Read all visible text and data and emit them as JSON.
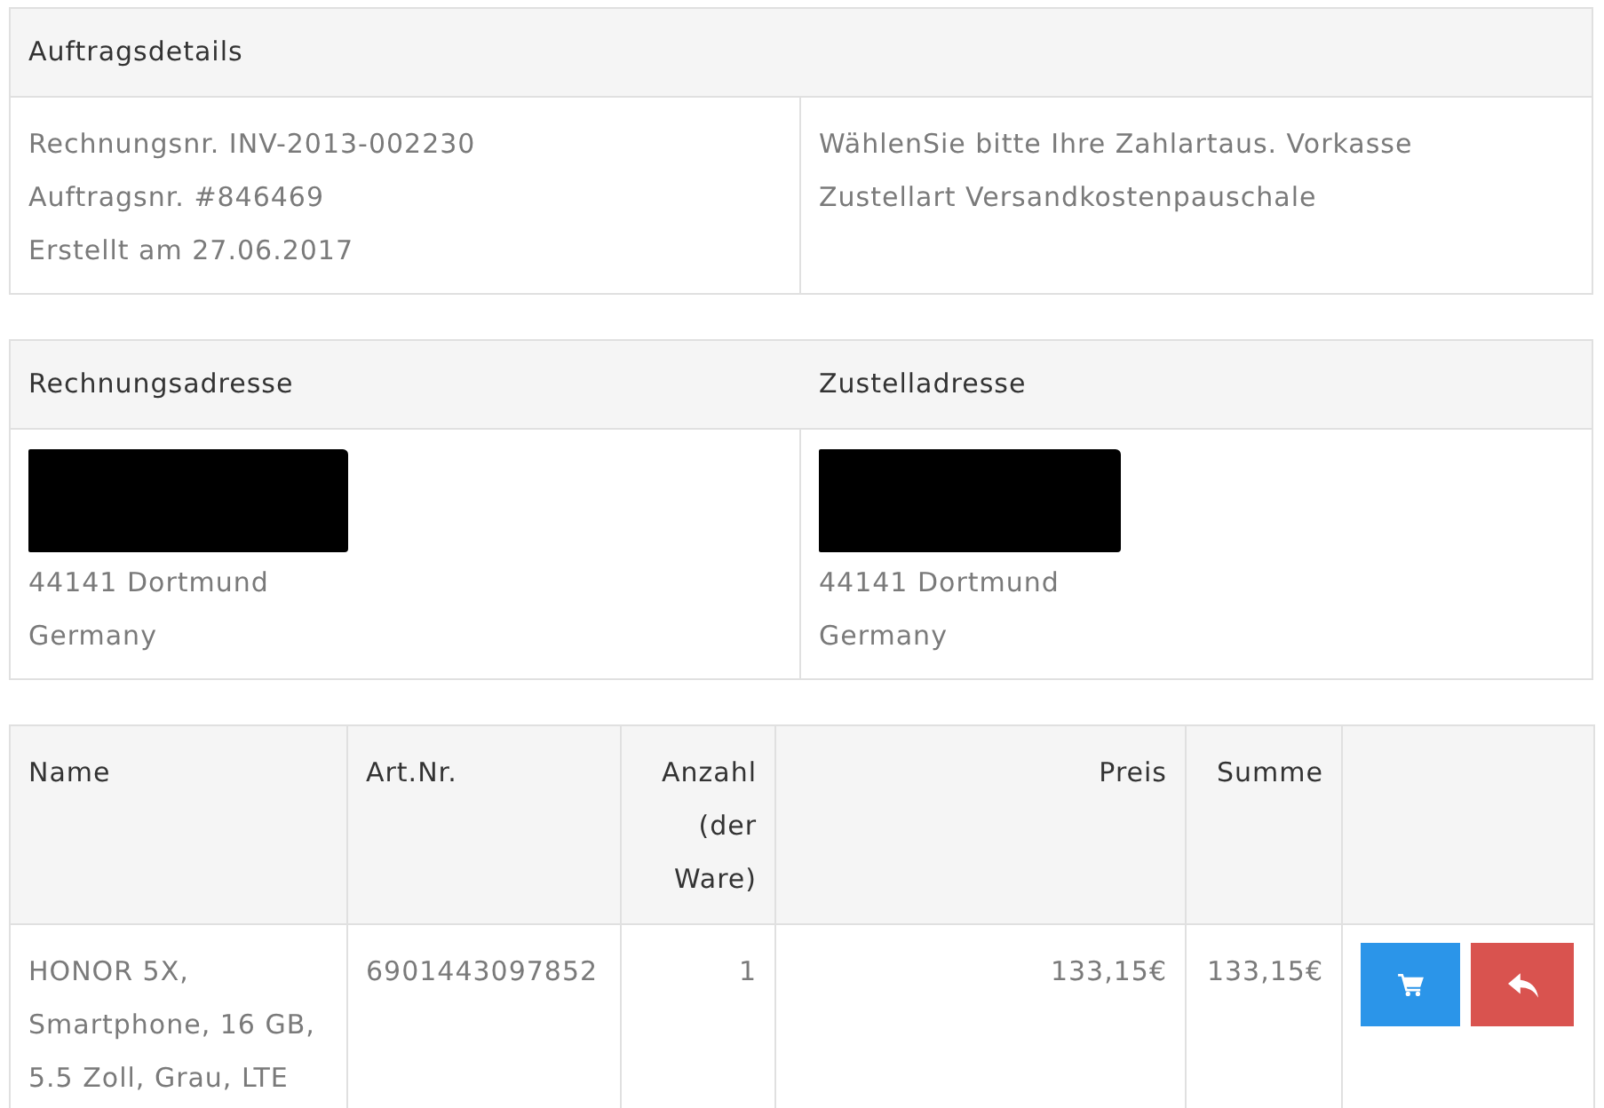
{
  "order_details": {
    "heading": "Auftragsdetails",
    "left_lines": [
      "Rechnungsnr. INV-2013-002230",
      "Auftragsnr. #846469",
      "Erstellt am 27.06.2017"
    ],
    "right_lines": [
      "WählenSie bitte Ihre Zahlartaus. Vorkasse",
      "Zustellart Versandkostenpauschale"
    ]
  },
  "addresses": [
    {
      "heading": "Rechnungsadresse",
      "redacted": true,
      "lines": [
        "44141 Dortmund",
        "Germany"
      ]
    },
    {
      "heading": "Zustelladresse",
      "redacted": true,
      "lines": [
        "44141 Dortmund",
        "Germany"
      ]
    }
  ],
  "items_table": {
    "columns": [
      {
        "label": "Name",
        "kind": "text"
      },
      {
        "label": "Art.Nr.",
        "kind": "text"
      },
      {
        "label": "Anzahl (der Ware)",
        "kind": "number"
      },
      {
        "label": "Preis",
        "kind": "number"
      },
      {
        "label": "Summe",
        "kind": "number"
      }
    ],
    "rows": [
      {
        "cells": [
          "HONOR 5X, Smartphone, 16 GB, 5.5 Zoll, Grau, LTE",
          "6901443097852",
          "1",
          "133,15€",
          "133,15€"
        ],
        "actions": [
          {
            "kind": "cart"
          },
          {
            "kind": "reply"
          }
        ]
      }
    ]
  }
}
